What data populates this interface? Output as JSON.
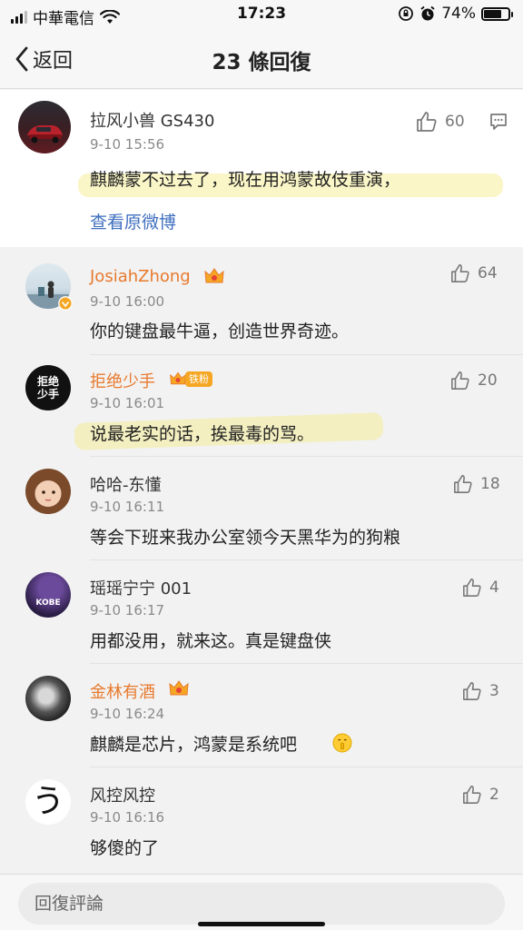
{
  "status_bar": {
    "carrier": "中華電信",
    "time": "17:23",
    "battery": "74%"
  },
  "nav": {
    "back_label": "返回",
    "title": "23 條回復"
  },
  "main_post": {
    "user": "拉风小兽 GS430",
    "time": "9-10 15:56",
    "text": "麒麟蒙不过去了，现在用鸿蒙故伎重演，",
    "likes": "60",
    "view_original": "查看原微博"
  },
  "replies": [
    {
      "user": "JosiahZhong",
      "time": "9-10 16:00",
      "text": "你的键盘最牛逼，创造世界奇迹。",
      "likes": "64"
    },
    {
      "user": "拒绝少手",
      "badge": "铁粉",
      "avatar_text": "拒绝\n少手",
      "time": "9-10 16:01",
      "text": "说最老实的话，挨最毒的骂。",
      "likes": "20"
    },
    {
      "user": "哈哈-东懂",
      "time": "9-10 16:11",
      "text": "等会下班来我办公室领今天黑华为的狗粮",
      "likes": "18"
    },
    {
      "user": "瑶瑶宁宁 001",
      "avatar_text": "KOBE",
      "time": "9-10 16:17",
      "text": "用都没用，就来这。真是键盘侠",
      "likes": "4"
    },
    {
      "user": "金林有酒",
      "time": "9-10 16:24",
      "text": "麒麟是芯片，鸿蒙是系统吧",
      "likes": "3"
    },
    {
      "user": "风控风控",
      "avatar_text": "う",
      "time": "9-10 16:16",
      "text": "够傻的了",
      "likes": "2"
    }
  ],
  "comment_box": {
    "placeholder": "回復評論"
  },
  "colors": {
    "vip_name": "#e8792d",
    "highlight": "#f5ec82",
    "link": "#3f6fbf"
  }
}
